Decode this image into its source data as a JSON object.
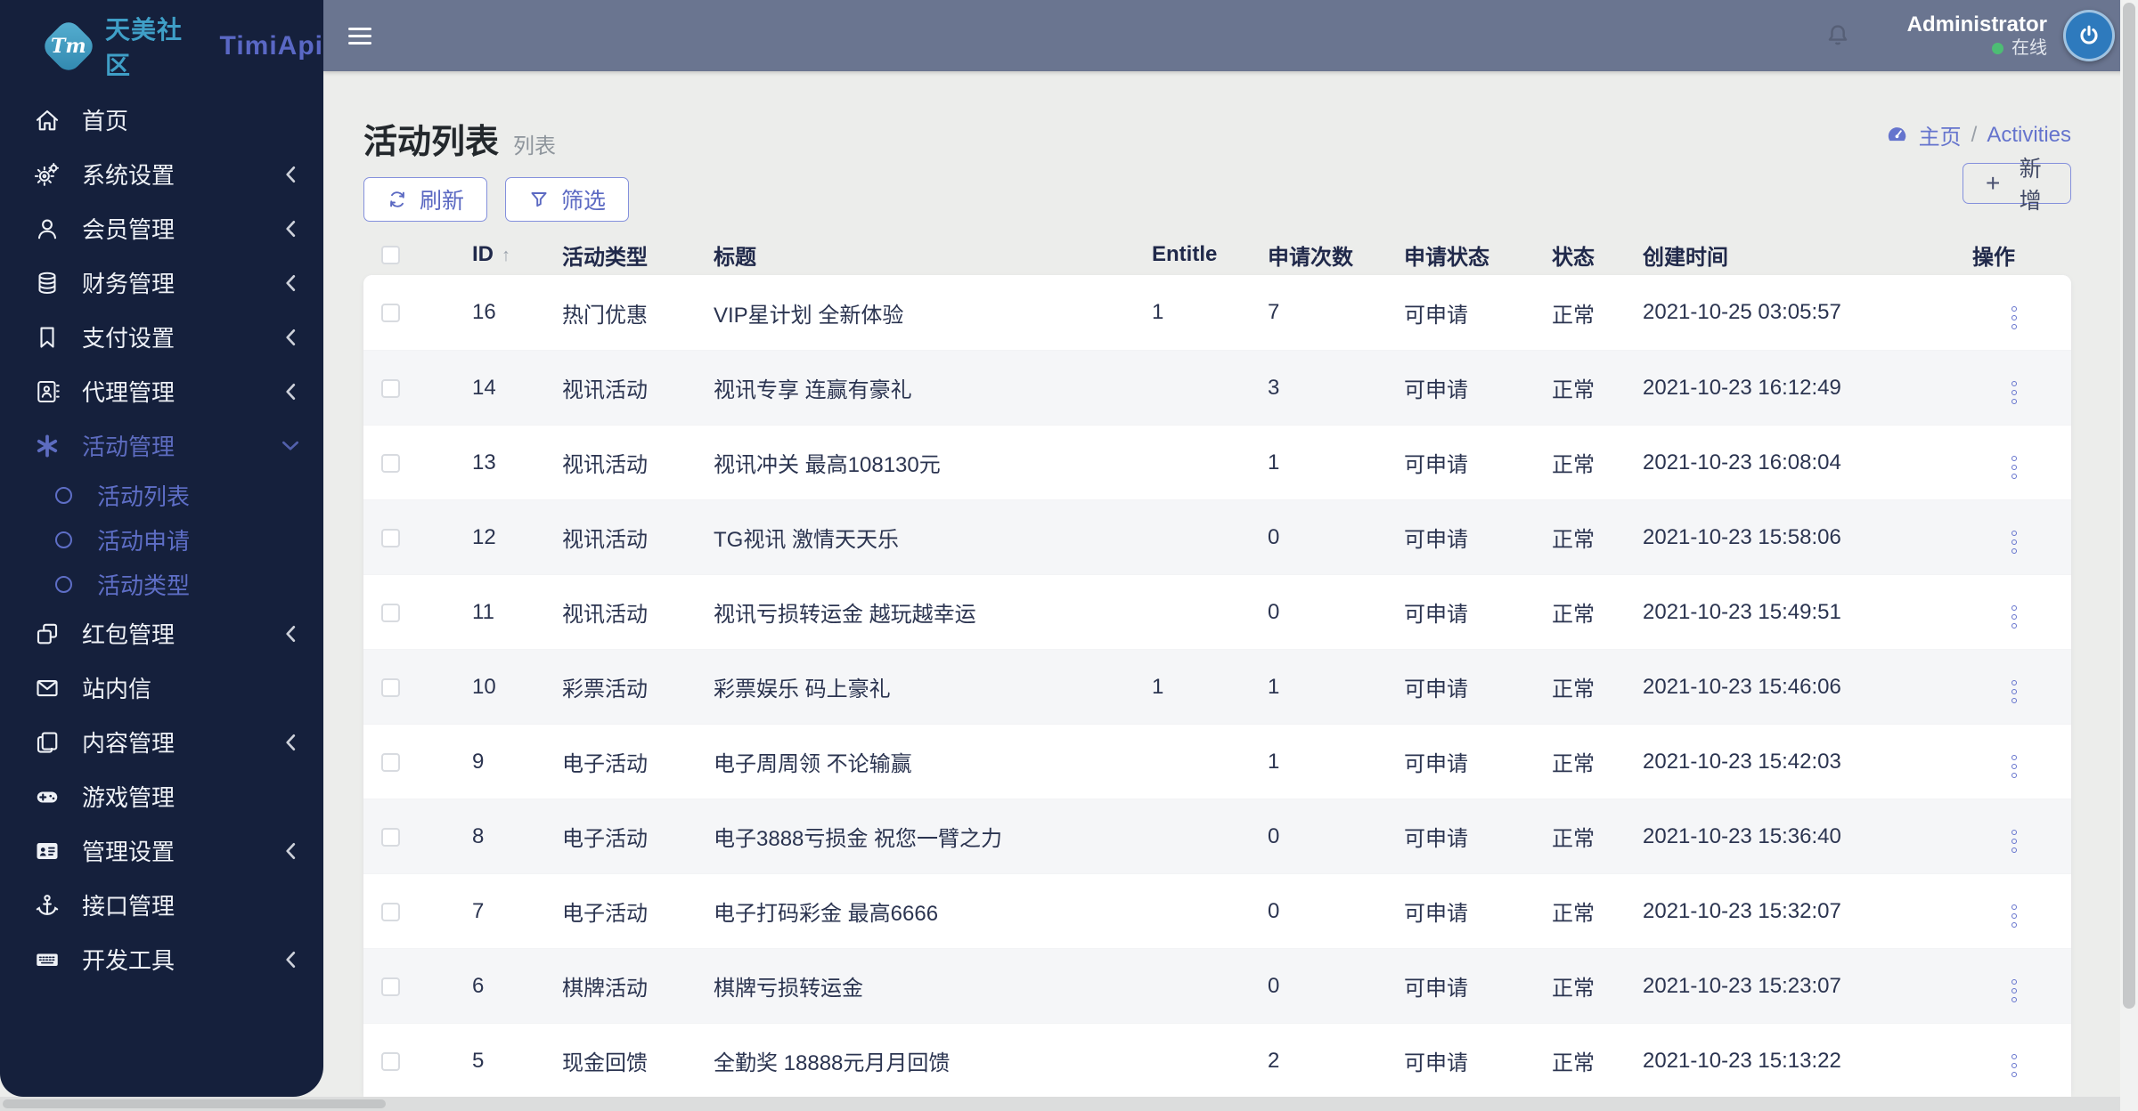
{
  "brand": {
    "logo_text": "Tm",
    "community_name": "天美社区",
    "app_name": "TimiApi"
  },
  "topbar": {
    "user_name": "Administrator",
    "online_status": "在线"
  },
  "sidebar": {
    "items": [
      {
        "key": "home",
        "label": "首页",
        "icon": "home"
      },
      {
        "key": "system",
        "label": "系统设置",
        "icon": "cogs",
        "chevron": "left"
      },
      {
        "key": "members",
        "label": "会员管理",
        "icon": "user",
        "chevron": "left"
      },
      {
        "key": "finance",
        "label": "财务管理",
        "icon": "database",
        "chevron": "left"
      },
      {
        "key": "payment",
        "label": "支付设置",
        "icon": "bookmark",
        "chevron": "left"
      },
      {
        "key": "agents",
        "label": "代理管理",
        "icon": "address-book",
        "chevron": "left"
      },
      {
        "key": "activities",
        "label": "活动管理",
        "icon": "asterisk",
        "chevron": "down",
        "active": true,
        "children": [
          {
            "label": "活动列表",
            "active": true
          },
          {
            "label": "活动申请"
          },
          {
            "label": "活动类型"
          }
        ]
      },
      {
        "key": "redpacket",
        "label": "红包管理",
        "icon": "clone",
        "chevron": "left"
      },
      {
        "key": "messages",
        "label": "站内信",
        "icon": "envelope"
      },
      {
        "key": "content",
        "label": "内容管理",
        "icon": "copy",
        "chevron": "left"
      },
      {
        "key": "games",
        "label": "游戏管理",
        "icon": "gamepad"
      },
      {
        "key": "admin",
        "label": "管理设置",
        "icon": "id-card",
        "chevron": "left"
      },
      {
        "key": "api",
        "label": "接口管理",
        "icon": "anchor"
      },
      {
        "key": "devtools",
        "label": "开发工具",
        "icon": "keyboard",
        "chevron": "left"
      }
    ]
  },
  "page": {
    "title": "活动列表",
    "subtitle": "列表",
    "breadcrumb": {
      "home": "主页",
      "separator": "/",
      "current": "Activities"
    }
  },
  "toolbar": {
    "refresh_label": "刷新",
    "filter_label": "筛选",
    "add_label": "新增",
    "plus_sign": "+"
  },
  "table": {
    "headers": {
      "id": "ID",
      "sort_icon": "↑",
      "type": "活动类型",
      "title": "标题",
      "entitle": "Entitle",
      "count": "申请次数",
      "apply_status": "申请状态",
      "status": "状态",
      "created": "创建时间",
      "actions": "操作"
    },
    "rows": [
      {
        "id": "16",
        "type": "热门优惠",
        "title": "VIP星计划 全新体验",
        "entitle": "1",
        "count": "7",
        "apply_status": "可申请",
        "status": "正常",
        "created": "2021-10-25 03:05:57"
      },
      {
        "id": "14",
        "type": "视讯活动",
        "title": "视讯专享 连赢有豪礼",
        "entitle": "",
        "count": "3",
        "apply_status": "可申请",
        "status": "正常",
        "created": "2021-10-23 16:12:49"
      },
      {
        "id": "13",
        "type": "视讯活动",
        "title": "视讯冲关 最高108130元",
        "entitle": "",
        "count": "1",
        "apply_status": "可申请",
        "status": "正常",
        "created": "2021-10-23 16:08:04"
      },
      {
        "id": "12",
        "type": "视讯活动",
        "title": "TG视讯 激情天天乐",
        "entitle": "",
        "count": "0",
        "apply_status": "可申请",
        "status": "正常",
        "created": "2021-10-23 15:58:06"
      },
      {
        "id": "11",
        "type": "视讯活动",
        "title": "视讯亏损转运金 越玩越幸运",
        "entitle": "",
        "count": "0",
        "apply_status": "可申请",
        "status": "正常",
        "created": "2021-10-23 15:49:51"
      },
      {
        "id": "10",
        "type": "彩票活动",
        "title": "彩票娱乐 码上豪礼",
        "entitle": "1",
        "count": "1",
        "apply_status": "可申请",
        "status": "正常",
        "created": "2021-10-23 15:46:06"
      },
      {
        "id": "9",
        "type": "电子活动",
        "title": "电子周周领 不论输赢",
        "entitle": "",
        "count": "1",
        "apply_status": "可申请",
        "status": "正常",
        "created": "2021-10-23 15:42:03"
      },
      {
        "id": "8",
        "type": "电子活动",
        "title": "电子3888亏损金 祝您一臂之力",
        "entitle": "",
        "count": "0",
        "apply_status": "可申请",
        "status": "正常",
        "created": "2021-10-23 15:36:40"
      },
      {
        "id": "7",
        "type": "电子活动",
        "title": "电子打码彩金 最高6666",
        "entitle": "",
        "count": "0",
        "apply_status": "可申请",
        "status": "正常",
        "created": "2021-10-23 15:32:07"
      },
      {
        "id": "6",
        "type": "棋牌活动",
        "title": "棋牌亏损转运金",
        "entitle": "",
        "count": "0",
        "apply_status": "可申请",
        "status": "正常",
        "created": "2021-10-23 15:23:07"
      },
      {
        "id": "5",
        "type": "现金回馈",
        "title": "全勤奖 18888元月月回馈",
        "entitle": "",
        "count": "2",
        "apply_status": "可申请",
        "status": "正常",
        "created": "2021-10-23 15:13:22"
      }
    ]
  },
  "colors": {
    "accent_indigo": "#6574cd",
    "sidebar_bg": "#15203c",
    "topbar_bg": "#6a7590",
    "online_green": "#4dbd74",
    "avatar_blue": "#2e7abd",
    "brand_teal": "#3f9fc7",
    "brand_purple": "#5a68c5"
  }
}
